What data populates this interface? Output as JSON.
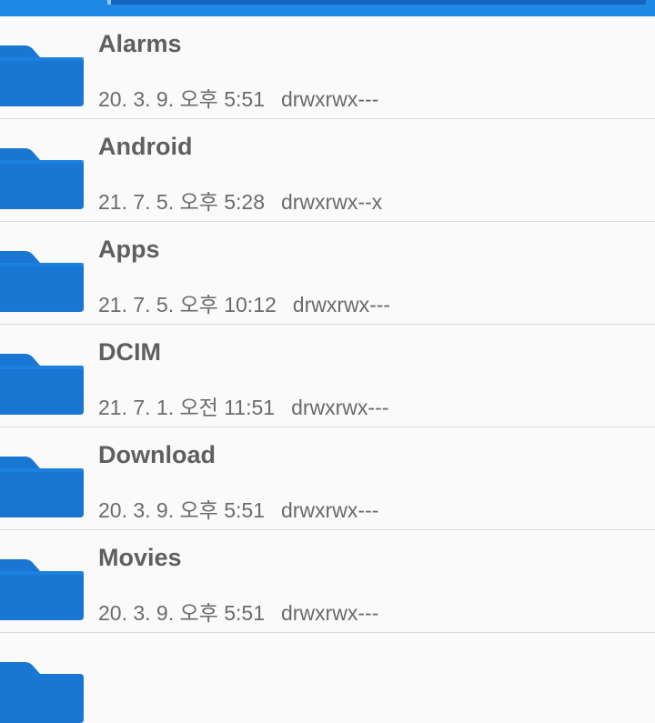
{
  "colors": {
    "accent": "#1e88e5",
    "folder": "#1976d2",
    "text_primary": "#5f5f5f",
    "text_secondary": "#6b6b6b"
  },
  "files": [
    {
      "name": "Alarms",
      "date": "20. 3. 9. 오후 5:51",
      "permissions": "drwxrwx---",
      "icon": "folder-icon"
    },
    {
      "name": "Android",
      "date": "21. 7. 5. 오후 5:28",
      "permissions": "drwxrwx--x",
      "icon": "folder-icon"
    },
    {
      "name": "Apps",
      "date": "21. 7. 5. 오후 10:12",
      "permissions": "drwxrwx---",
      "icon": "folder-icon"
    },
    {
      "name": "DCIM",
      "date": "21. 7. 1. 오전 11:51",
      "permissions": "drwxrwx---",
      "icon": "folder-icon"
    },
    {
      "name": "Download",
      "date": "20. 3. 9. 오후 5:51",
      "permissions": "drwxrwx---",
      "icon": "folder-icon"
    },
    {
      "name": "Movies",
      "date": "20. 3. 9. 오후 5:51",
      "permissions": "drwxrwx---",
      "icon": "folder-icon"
    }
  ]
}
